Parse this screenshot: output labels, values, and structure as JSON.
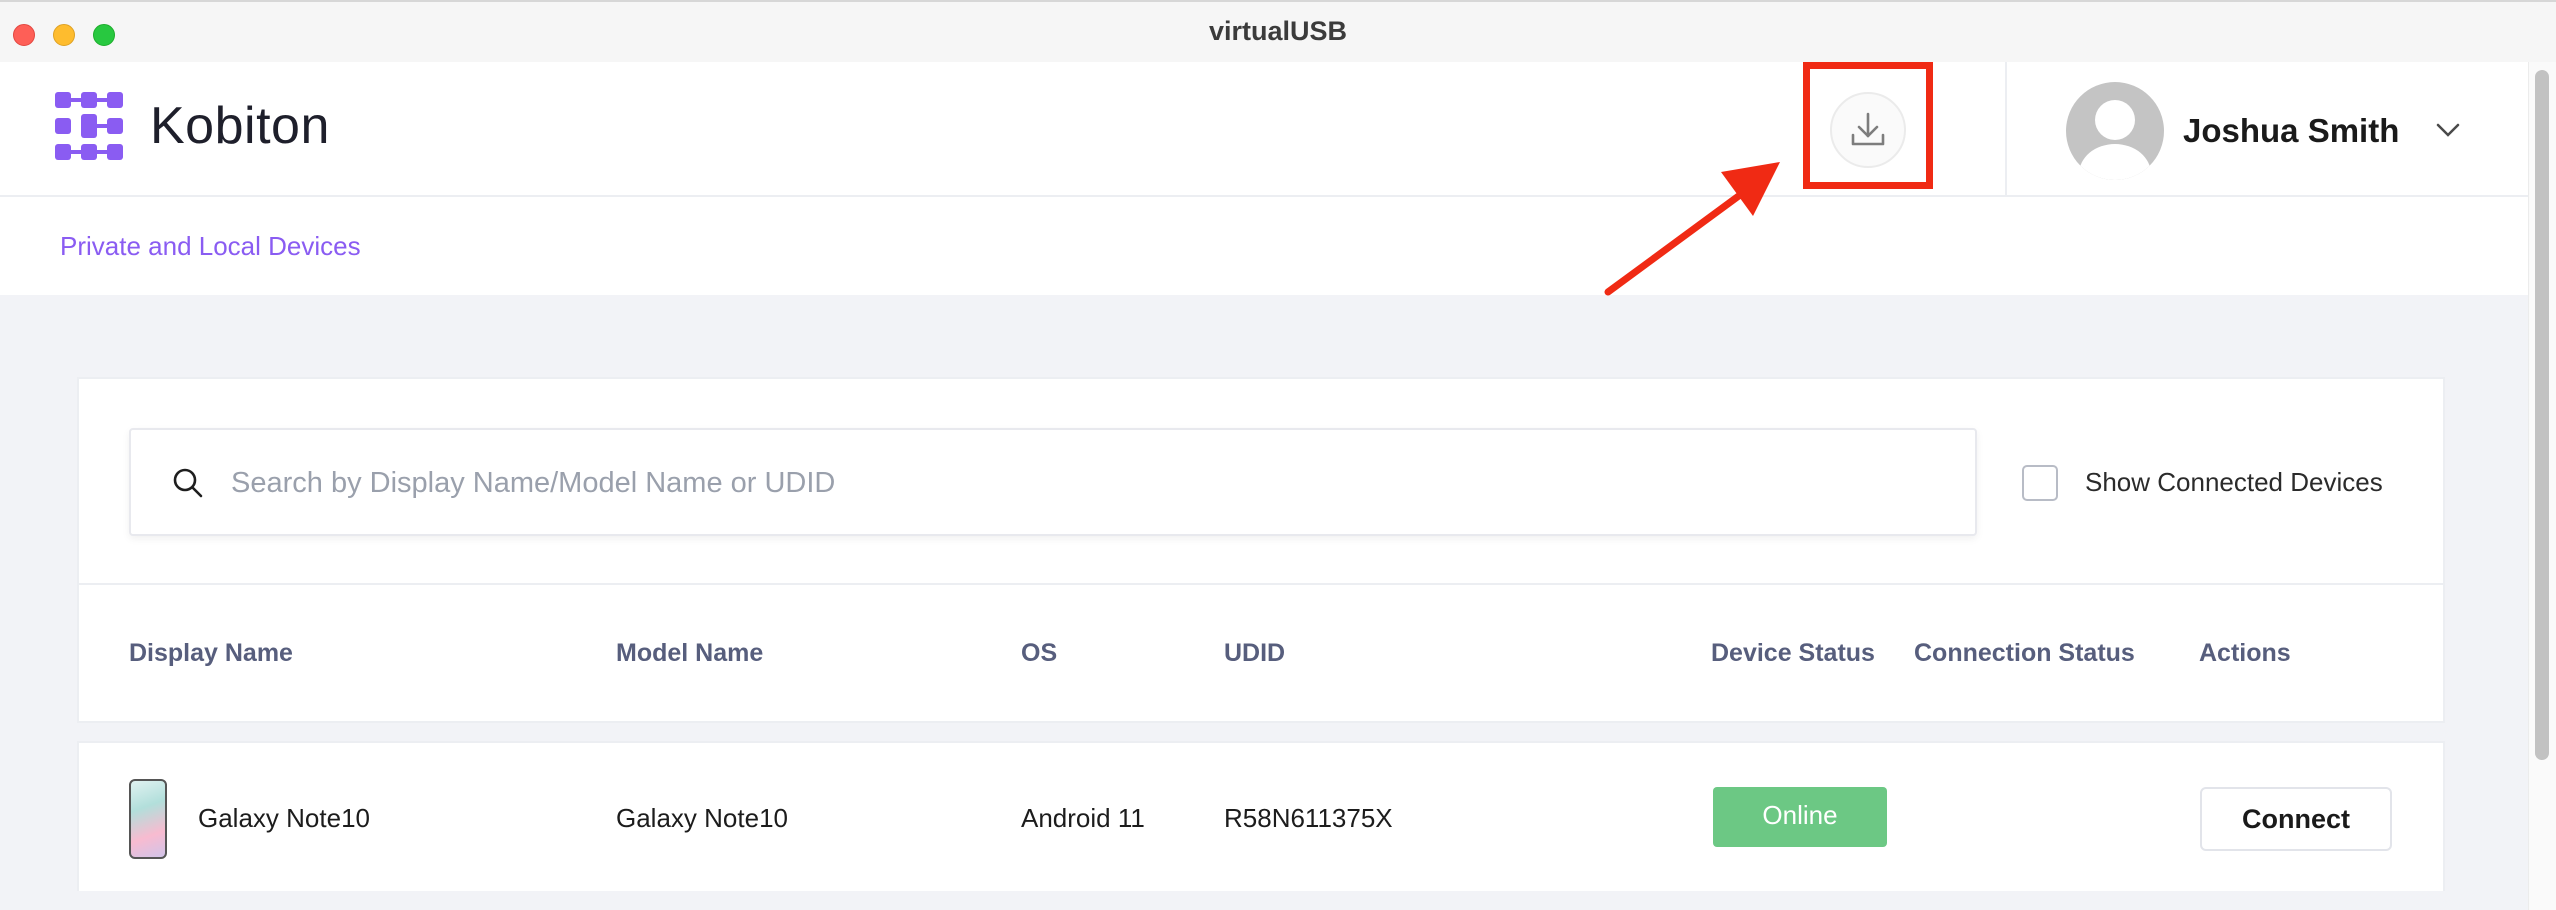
{
  "window": {
    "title": "virtualUSB"
  },
  "header": {
    "logo_text": "Kobiton",
    "user_name": "Joshua Smith"
  },
  "nav": {
    "link": "Private and Local Devices"
  },
  "filter": {
    "search_placeholder": "Search by Display Name/Model Name or UDID",
    "checkbox_label": "Show Connected Devices",
    "checkbox_checked": false
  },
  "table": {
    "headers": [
      "Display Name",
      "Model Name",
      "OS",
      "UDID",
      "Device Status",
      "Connection Status",
      "Actions"
    ],
    "rows": [
      {
        "display_name": "Galaxy Note10",
        "model_name": "Galaxy Note10",
        "os": "Android 11",
        "udid": "R58N611375X",
        "device_status": "Online",
        "connection_status": "",
        "action": "Connect"
      }
    ]
  },
  "colors": {
    "brand": "#8a5cf2",
    "online": "#6cc884",
    "annotation": "#f02a14"
  },
  "icons": [
    "logo-icon",
    "download-icon",
    "avatar-icon",
    "chevron-down-icon",
    "search-icon",
    "phone-thumbnail"
  ]
}
